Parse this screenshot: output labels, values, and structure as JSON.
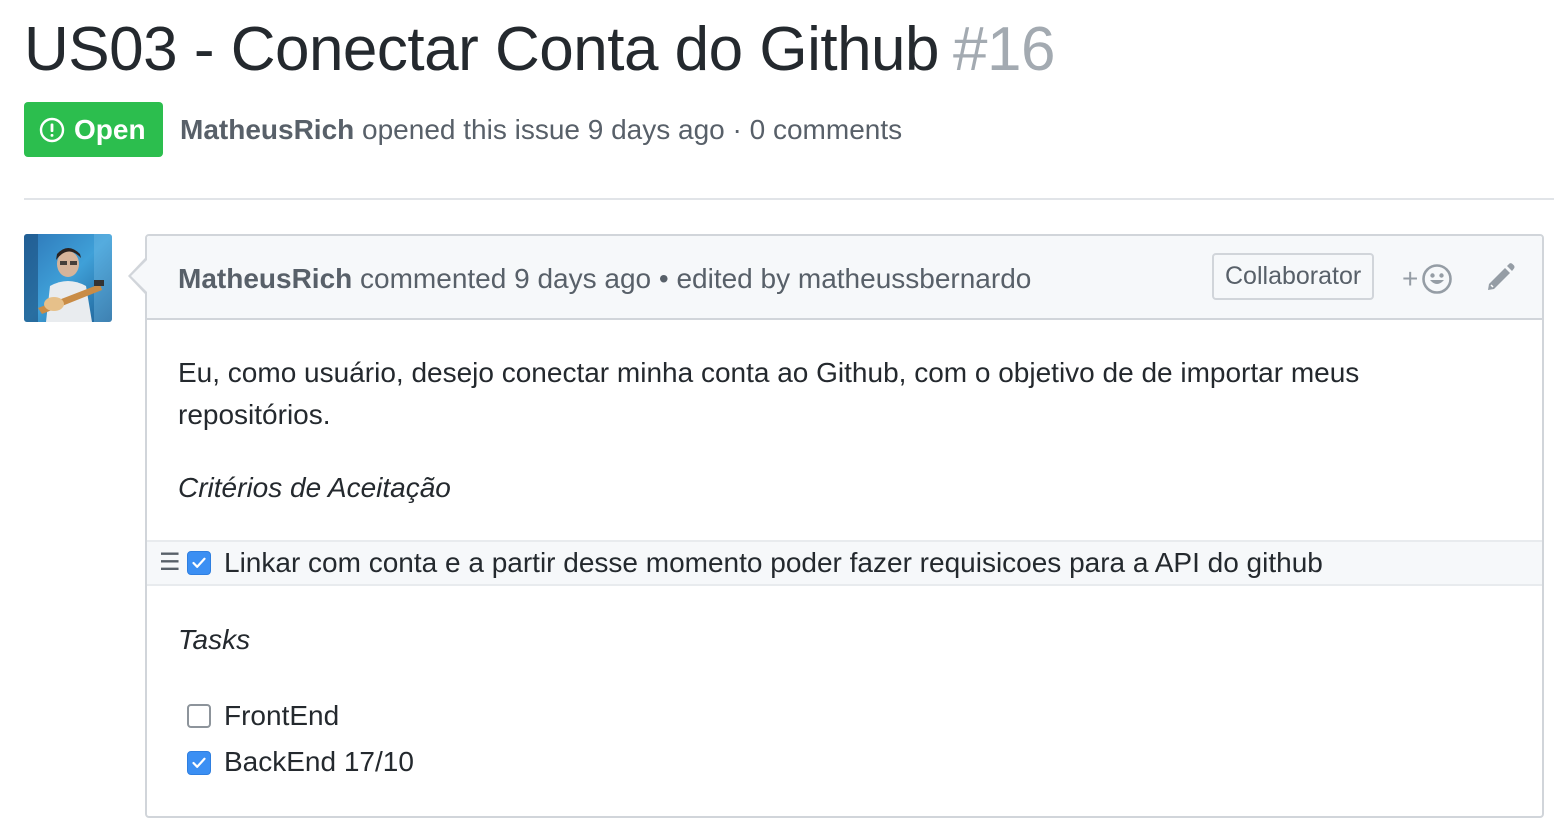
{
  "issue": {
    "title": "US03 - Conectar Conta do Github",
    "number": "#16",
    "state_label": "Open",
    "state_color": "#2cbe4e",
    "meta_author": "MatheusRich",
    "meta_rest": "opened this issue 9 days ago · 0 comments"
  },
  "comment": {
    "author": "MatheusRich",
    "action": "commented 9 days ago",
    "edited": "• edited by matheussbernardo",
    "role_badge": "Collaborator",
    "reaction_plus": "+",
    "body": "Eu, como usuário, desejo conectar minha conta ao Github, com o objetivo de de importar meus repositórios.",
    "criteria_heading": "Critérios de Aceitação",
    "criteria_task": {
      "label": "Linkar com conta e a partir desse momento poder fazer requisicoes para a API do github",
      "checked": true
    },
    "drag_handle": "☰",
    "tasks_heading": "Tasks",
    "tasks": [
      {
        "label": "FrontEnd",
        "checked": false
      },
      {
        "label": "BackEnd 17/10",
        "checked": true
      }
    ]
  },
  "icons": {
    "state": "issue-opened-icon",
    "reaction": "smiley-icon",
    "edit": "pencil-icon",
    "avatar": "user-avatar"
  }
}
